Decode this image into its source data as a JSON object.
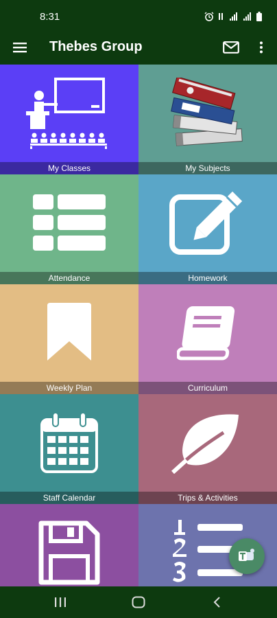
{
  "status_bar": {
    "time": "8:31"
  },
  "app_bar": {
    "title": "Thebes Group"
  },
  "tiles": [
    {
      "label": "My Classes",
      "icon": "classroom-icon",
      "color": "#5b3ff6"
    },
    {
      "label": "My Subjects",
      "icon": "books-stack-icon",
      "color": "#5f9e93"
    },
    {
      "label": "Attendance",
      "icon": "list-table-icon",
      "color": "#6fb58a"
    },
    {
      "label": "Homework",
      "icon": "edit-square-icon",
      "color": "#5aa6c8"
    },
    {
      "label": "Weekly Plan",
      "icon": "bookmark-icon",
      "color": "#e3bd84"
    },
    {
      "label": "Curriculum",
      "icon": "book-icon",
      "color": "#bf7fba"
    },
    {
      "label": "Staff Calendar",
      "icon": "calendar-icon",
      "color": "#3d8f90"
    },
    {
      "label": "Trips & Activities",
      "icon": "leaf-icon",
      "color": "#a8687b"
    },
    {
      "label": "",
      "icon": "floppy-disk-icon",
      "color": "#8c4fa0"
    },
    {
      "label": "",
      "icon": "numbered-list-icon",
      "color": "#6d73ad"
    }
  ],
  "colors": {
    "app_bar": "#0d3a0f",
    "fab": "#4a8a66"
  },
  "fab": {
    "icon": "teams-icon"
  },
  "nav_bar": {
    "buttons": [
      "recent-apps-icon",
      "home-icon",
      "back-icon"
    ]
  }
}
